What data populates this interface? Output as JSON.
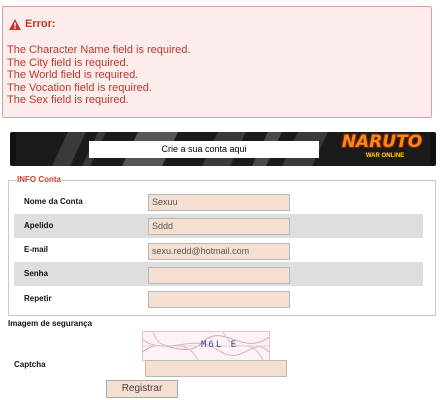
{
  "error": {
    "title": "Error:",
    "icon": "warning-icon",
    "color": "#c0392b",
    "messages": [
      "The Character Name field is required.",
      "The City field is required.",
      "The World field is required.",
      "The Vocation field is required.",
      "The Sex field is required."
    ]
  },
  "banner": {
    "label": "Crie a sua conta aqui",
    "logo_text": "NARUTO",
    "logo_subtext": "WAR ONLINE"
  },
  "form": {
    "legend": "INFO Conta",
    "fields": [
      {
        "label": "Nome da Conta",
        "value": "Sexuu"
      },
      {
        "label": "Apelido",
        "value": "Sddd"
      },
      {
        "label": "E-mail",
        "value": "sexu.redd@hotmail.com"
      },
      {
        "label": "Senha",
        "value": ""
      },
      {
        "label": "Repetir",
        "value": ""
      }
    ]
  },
  "security": {
    "section_label": "Imagem de segurança",
    "captcha_text": "M6L E",
    "captcha_label": "Captcha",
    "captcha_value": ""
  },
  "submit_label": "Registrar"
}
